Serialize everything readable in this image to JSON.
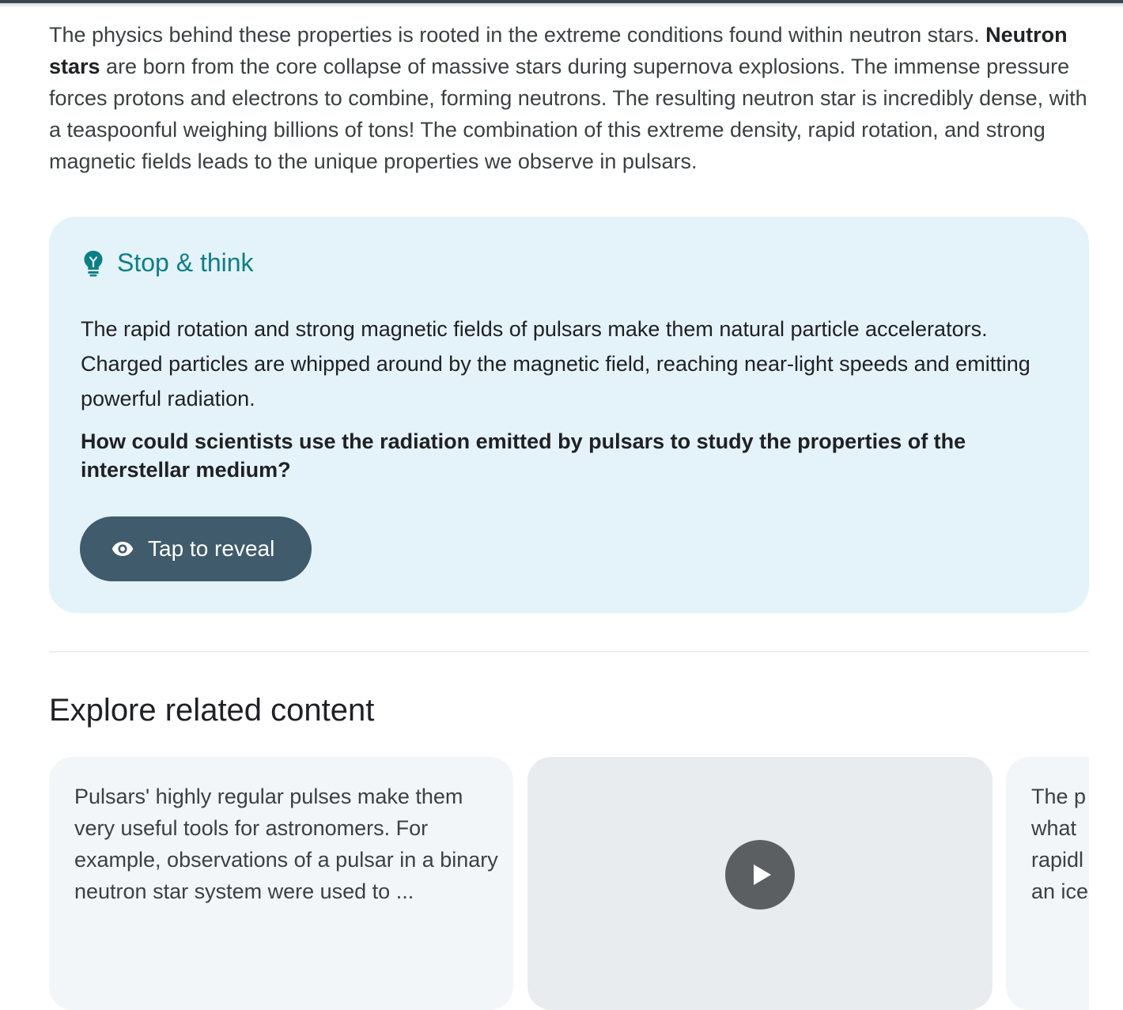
{
  "intro": {
    "text_before": "The physics behind these properties is rooted in the extreme conditions found within neutron stars. ",
    "bold": "Neutron stars",
    "text_after": " are born from the core collapse of massive stars during supernova explosions. The immense pressure forces protons and electrons to combine, forming neutrons. The resulting neutron star is incredibly dense, with a teaspoonful weighing billions of tons! The combination of this extreme density, rapid rotation, and strong magnetic fields leads to the unique properties we observe in pulsars."
  },
  "callout": {
    "icon": "lightbulb-icon",
    "title": "Stop & think",
    "body": "The rapid rotation and strong magnetic fields of pulsars make them natural particle accelerators. Charged particles are whipped around by the magnetic field, reaching near-light speeds and emitting powerful radiation.",
    "question": "How could scientists use the radiation emitted by pulsars to study the properties of the interstellar medium?",
    "reveal_button": {
      "icon": "eye-icon",
      "label": "Tap to reveal"
    }
  },
  "related": {
    "title": "Explore related content",
    "cards": [
      {
        "type": "text",
        "text": "Pulsars' highly regular pulses make them very useful tools for astronomers. For example, observations of a pulsar in a binary neutron star system were used to ..."
      },
      {
        "type": "video",
        "icon": "play-icon"
      },
      {
        "type": "text",
        "lines": [
          "The p",
          "what",
          "rapidl",
          "an ice"
        ]
      }
    ]
  },
  "colors": {
    "accent_teal": "#0b7f86",
    "callout_bg": "#e4f3f9",
    "button_bg": "#3f5b6c"
  }
}
